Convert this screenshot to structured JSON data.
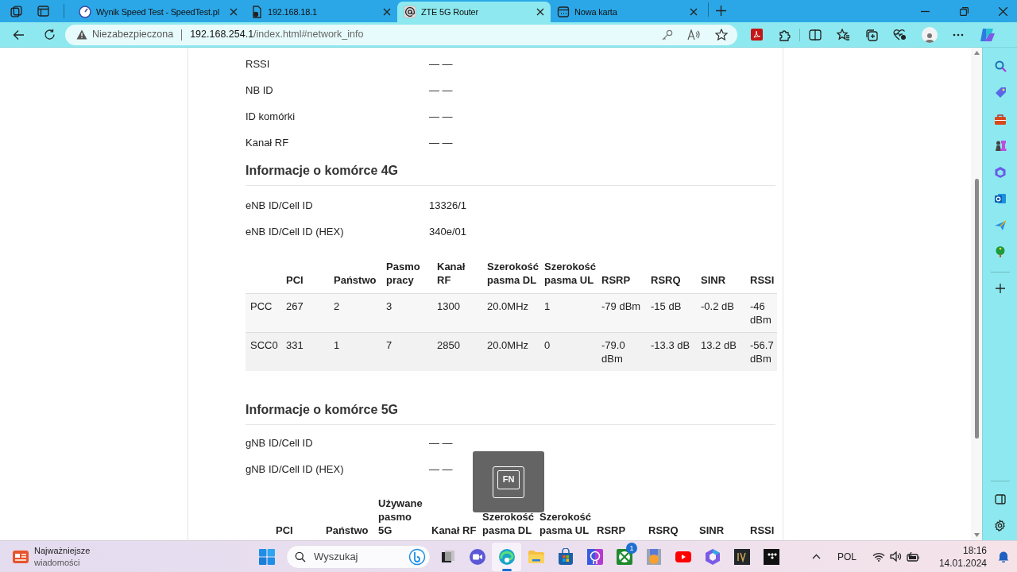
{
  "browser": {
    "tabs": [
      {
        "title": "Wynik Speed Test - SpeedTest.pl",
        "selected": false
      },
      {
        "title": "192.168.18.1",
        "selected": false
      },
      {
        "title": "ZTE 5G Router",
        "selected": true
      },
      {
        "title": "Nowa karta",
        "selected": false
      }
    ],
    "address_bar": {
      "security_label": "Niezabezpieczona",
      "host": "192.168.254.1",
      "path": "/index.html#network_info"
    }
  },
  "page": {
    "top_rows": [
      {
        "label": "RSSI",
        "value": "— —"
      },
      {
        "label": "NB ID",
        "value": "— —"
      },
      {
        "label": "ID komórki",
        "value": "— —"
      },
      {
        "label": "Kanał RF",
        "value": "— —"
      }
    ],
    "cell_4g": {
      "title": "Informacje o komórce 4G",
      "rows": [
        {
          "label": "eNB ID/Cell ID",
          "value": "13326/1"
        },
        {
          "label": "eNB ID/Cell ID (HEX)",
          "value": "340e/01"
        }
      ],
      "table": {
        "columns": [
          "",
          "PCI",
          "Państwo",
          "Pasmo pracy",
          "Kanał RF",
          "Szerokość pasma DL",
          "Szerokość pasma UL",
          "RSRP",
          "RSRQ",
          "SINR",
          "RSSI"
        ],
        "rows": [
          [
            "PCC",
            "267",
            "2",
            "3",
            "1300",
            "20.0MHz",
            "1",
            "-79 dBm",
            "-15 dB",
            "-0.2 dB",
            "-46 dBm"
          ],
          [
            "SCC0",
            "331",
            "1",
            "7",
            "2850",
            "20.0MHz",
            "0",
            "-79.0 dBm",
            "-13.3 dB",
            "13.2 dB",
            "-56.7 dBm"
          ]
        ]
      }
    },
    "cell_5g": {
      "title": "Informacje o komórce 5G",
      "rows": [
        {
          "label": "gNB ID/Cell ID",
          "value": "— —"
        },
        {
          "label": "gNB ID/Cell ID (HEX)",
          "value": "— —"
        }
      ],
      "table": {
        "columns": [
          "",
          "PCI",
          "Państwo",
          "Używane pasmo 5G",
          "Kanał RF",
          "Szerokość pasma DL",
          "Szerokość pasma UL",
          "RSRP",
          "RSRQ",
          "SINR",
          "RSSI"
        ]
      }
    }
  },
  "overlay": {
    "key_label": "FN"
  },
  "taskbar": {
    "news_title": "Najważniejsze",
    "news_subtitle": "wiadomości",
    "search_placeholder": "Wyszukaj",
    "xbox_badge": "1",
    "language": "POL",
    "time": "18:16",
    "date": "14.01.2024"
  }
}
